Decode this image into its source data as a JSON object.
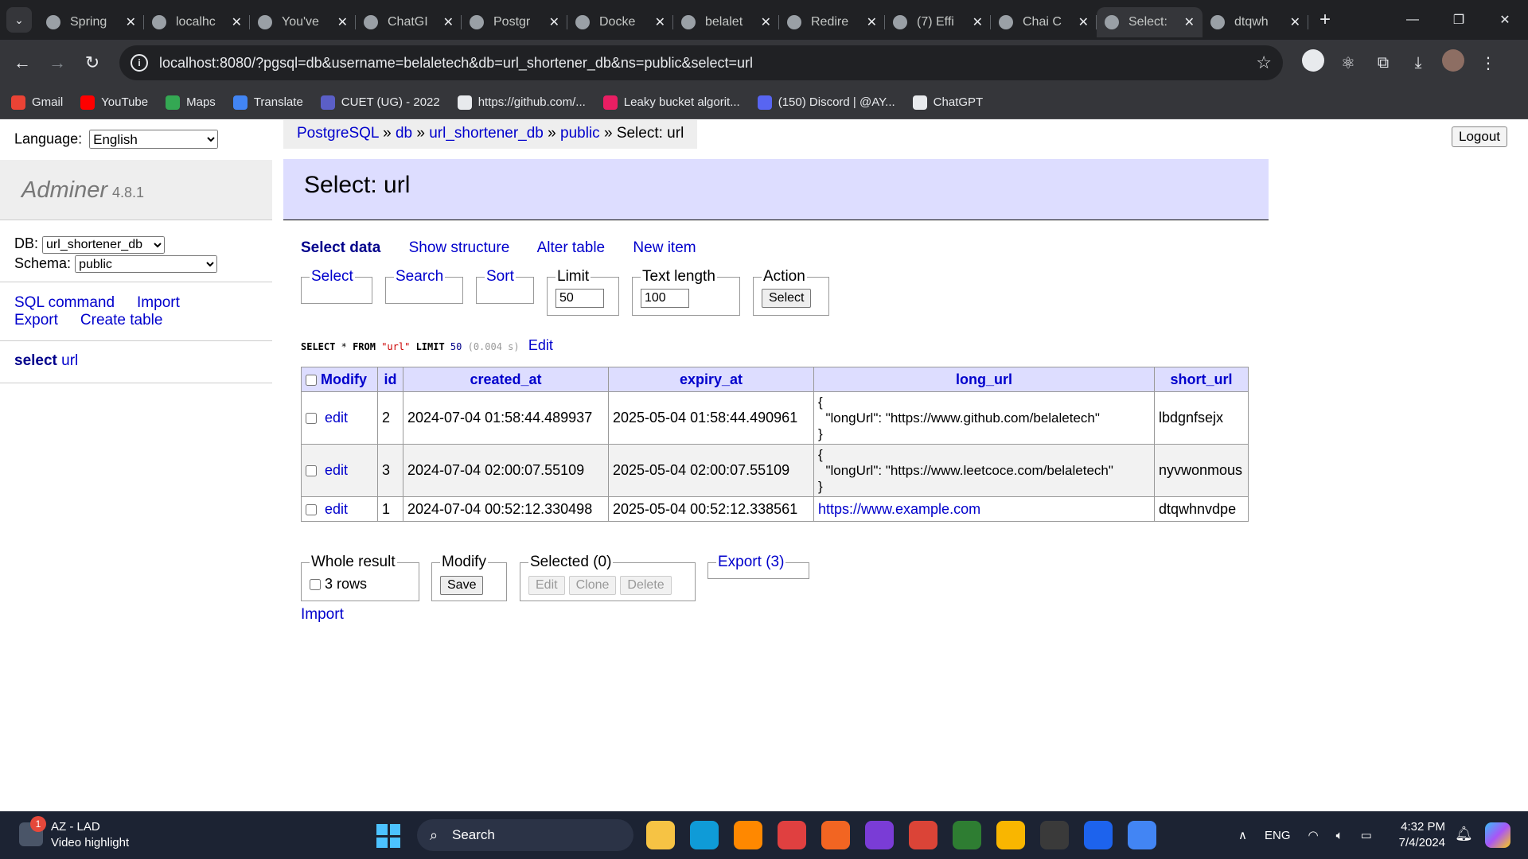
{
  "browser": {
    "tabs": [
      {
        "title": "Spring",
        "active": false
      },
      {
        "title": "localhc",
        "active": false
      },
      {
        "title": "You've",
        "active": false
      },
      {
        "title": "ChatGI",
        "active": false
      },
      {
        "title": "Postgr",
        "active": false
      },
      {
        "title": "Docke",
        "active": false
      },
      {
        "title": "belalet",
        "active": false
      },
      {
        "title": "Redire",
        "active": false
      },
      {
        "title": "(7) Effi",
        "active": false
      },
      {
        "title": "Chai C",
        "active": false
      },
      {
        "title": "Select:",
        "active": true
      },
      {
        "title": "dtqwh",
        "active": false
      }
    ],
    "url": "localhost:8080/?pgsql=db&username=belaletech&db=url_shortener_db&ns=public&select=url",
    "bookmarks": [
      {
        "label": "Gmail",
        "icon": "gmail-icon",
        "color": "#ea4335"
      },
      {
        "label": "YouTube",
        "icon": "youtube-icon",
        "color": "#ff0000"
      },
      {
        "label": "Maps",
        "icon": "maps-icon",
        "color": "#34a853"
      },
      {
        "label": "Translate",
        "icon": "translate-icon",
        "color": "#4285f4"
      },
      {
        "label": "CUET (UG) - 2022",
        "icon": "cuet-icon",
        "color": "#5b5fc7"
      },
      {
        "label": "https://github.com/...",
        "icon": "github-icon",
        "color": "#e8eaed"
      },
      {
        "label": "Leaky bucket algorit...",
        "icon": "leaky-icon",
        "color": "#e91e63"
      },
      {
        "label": "(150) Discord | @AY...",
        "icon": "discord-icon",
        "color": "#5865f2"
      },
      {
        "label": "ChatGPT",
        "icon": "chatgpt-icon",
        "color": "#e8eaed"
      }
    ]
  },
  "sidebar": {
    "language_label": "Language:",
    "language_value": "English",
    "app_name": "Adminer",
    "app_version": "4.8.1",
    "db_label": "DB:",
    "db_value": "url_shortener_db",
    "schema_label": "Schema:",
    "schema_value": "public",
    "links": [
      "SQL command",
      "Import",
      "Export",
      "Create table"
    ],
    "select_label": "select",
    "select_table": "url"
  },
  "header": {
    "breadcrumb": [
      "PostgreSQL",
      "db",
      "url_shortener_db",
      "public"
    ],
    "breadcrumb_sep": "»",
    "breadcrumb_current": "Select: url",
    "logout": "Logout",
    "title": "Select: url"
  },
  "subnav": {
    "current": "Select data",
    "links": [
      "Show structure",
      "Alter table",
      "New item"
    ]
  },
  "filters": {
    "select": "Select",
    "search": "Search",
    "sort": "Sort",
    "limit_label": "Limit",
    "limit_value": "50",
    "text_length_label": "Text length",
    "text_length_value": "100",
    "action_label": "Action",
    "action_button": "Select"
  },
  "query": {
    "kw1": "SELECT",
    "star": "*",
    "kw2": "FROM",
    "table": "\"url\"",
    "kw3": "LIMIT",
    "limit": "50",
    "time": "(0.004 s)",
    "edit": "Edit"
  },
  "table": {
    "headers": [
      "Modify",
      "id",
      "created_at",
      "expiry_at",
      "long_url",
      "short_url"
    ],
    "edit_label": "edit",
    "rows": [
      {
        "id": "2",
        "created_at": "2024-07-04 01:58:44.489937",
        "expiry_at": "2025-05-04 01:58:44.490961",
        "long_url": "{\n  \"longUrl\": \"https://www.github.com/belaletech\"\n}",
        "long_url_is_link": false,
        "short_url": "lbdgnfsejx"
      },
      {
        "id": "3",
        "created_at": "2024-07-04 02:00:07.55109",
        "expiry_at": "2025-05-04 02:00:07.55109",
        "long_url": "{\n  \"longUrl\": \"https://www.leetcoce.com/belaletech\"\n}",
        "long_url_is_link": false,
        "short_url": "nyvwonmous"
      },
      {
        "id": "1",
        "created_at": "2024-07-04 00:52:12.330498",
        "expiry_at": "2025-05-04 00:52:12.338561",
        "long_url": "https://www.example.com",
        "long_url_is_link": true,
        "short_url": "dtqwhnvdpe"
      }
    ]
  },
  "footer_actions": {
    "whole_result_label": "Whole result",
    "rows_text": "3 rows",
    "modify_label": "Modify",
    "save": "Save",
    "selected_label": "Selected (0)",
    "edit": "Edit",
    "clone": "Clone",
    "delete": "Delete",
    "export_label": "Export (3)",
    "import": "Import"
  },
  "taskbar": {
    "news_title": "AZ - LAD",
    "news_sub": "Video highlight",
    "news_badge": "1",
    "search": "Search",
    "lang": "ENG",
    "time": "4:32 PM",
    "date": "7/4/2024",
    "app_colors": [
      "#f6c344",
      "#0f9bd7",
      "#ff8800",
      "#e04040",
      "#f26522",
      "#7a3cd6",
      "#db4437",
      "#2e7d32",
      "#f9b600",
      "#3a3a3a",
      "#1d63ed",
      "#4285f4"
    ]
  }
}
